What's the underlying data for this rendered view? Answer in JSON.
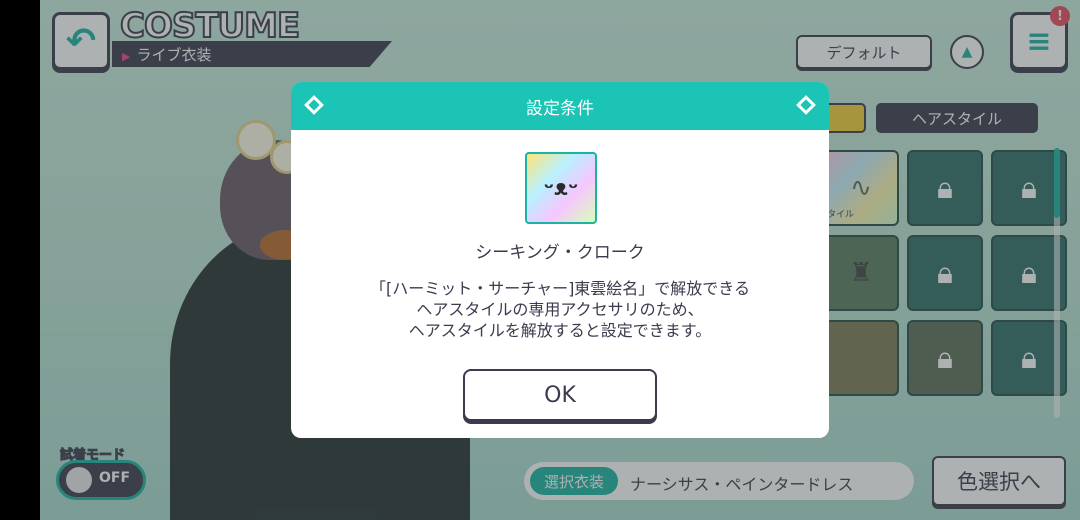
{
  "header": {
    "back_icon": "back-arrow-icon",
    "title_en": "COSTUME",
    "title_jp": "ライブ衣装",
    "default_label": "デフォルト",
    "up_icon": "triangle-up-icon",
    "menu_icon": "hamburger-menu-icon",
    "alert_badge": "!"
  },
  "panel": {
    "hairstyle_tab": "ヘアスタイル",
    "slots": [
      {
        "state": "rainbow",
        "badge": "タイル"
      },
      {
        "state": "locked"
      },
      {
        "state": "locked"
      },
      {
        "state": "dim"
      },
      {
        "state": "locked"
      },
      {
        "state": "locked"
      },
      {
        "state": "dim"
      },
      {
        "state": "locked"
      },
      {
        "state": "locked"
      }
    ]
  },
  "bottom": {
    "trial_mode_label": "試着モード",
    "toggle_value": "OFF",
    "selected_tag": "選択衣装",
    "selected_name": "ナーシサス・ペインタードレス",
    "color_select_label": "色選択へ"
  },
  "modal": {
    "title": "設定条件",
    "item_name": "シーキング・クローク",
    "desc_line1": "「[ハーミット・サーチャー]東雲絵名」で解放できる",
    "desc_line2": "ヘアスタイルの専用アクセサリのため、",
    "desc_line3": "ヘアスタイルを解放すると設定できます。",
    "ok_label": "OK"
  },
  "colors": {
    "accent": "#1bc4b4",
    "dark": "#3b3b4f",
    "pink": "#e64593",
    "yellow": "#f3cf38"
  }
}
